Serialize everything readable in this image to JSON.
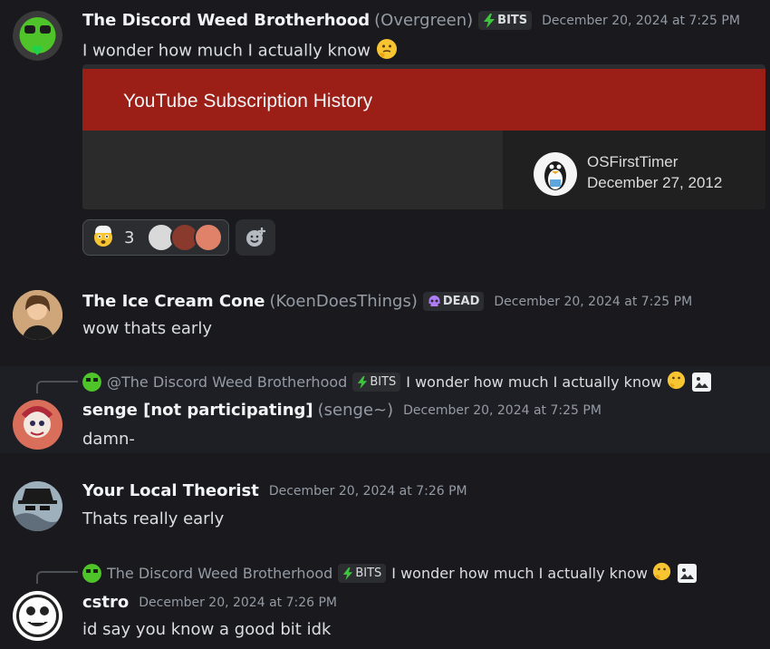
{
  "messages": [
    {
      "username": "The Discord Weed Brotherhood",
      "nickname": "(Overgreen)",
      "tag": "BITS",
      "timestamp": "December 20, 2024 at 7:25 PM",
      "text": "I wonder how much I actually know",
      "embed": {
        "title": "YouTube Subscription History",
        "channel_name": "OSFirstTimer",
        "channel_date": "December 27, 2012"
      },
      "reaction": {
        "count": "3"
      }
    },
    {
      "username": "The Ice Cream Cone",
      "nickname": "(KoenDoesThings)",
      "tag": "DEAD",
      "timestamp": "December 20, 2024 at 7:25 PM",
      "text": "wow thats early"
    },
    {
      "reply": {
        "name": "@The Discord Weed Brotherhood",
        "tag": "BITS",
        "text": "I wonder how much I actually know"
      },
      "username": "senge [not participating]",
      "nickname": "(senge~)",
      "timestamp": "December 20, 2024 at 7:25 PM",
      "text": "damn-"
    },
    {
      "username": "Your Local Theorist",
      "timestamp": "December 20, 2024 at 7:26 PM",
      "text": "Thats really early"
    },
    {
      "reply": {
        "name": "The Discord Weed Brotherhood",
        "tag": "BITS",
        "text": "I wonder how much I actually know"
      },
      "username": "cstro",
      "timestamp": "December 20, 2024 at 7:26 PM",
      "text": "id say you know a good bit idk"
    }
  ],
  "colors": {
    "background": "#1a1a1e",
    "embed_banner": "#9b1f16",
    "muted_text": "#949ba4"
  },
  "icons": [
    "thinking-emoji",
    "exploding-head-emoji",
    "lightning-icon",
    "skull-icon",
    "add-reaction-icon",
    "image-icon"
  ]
}
